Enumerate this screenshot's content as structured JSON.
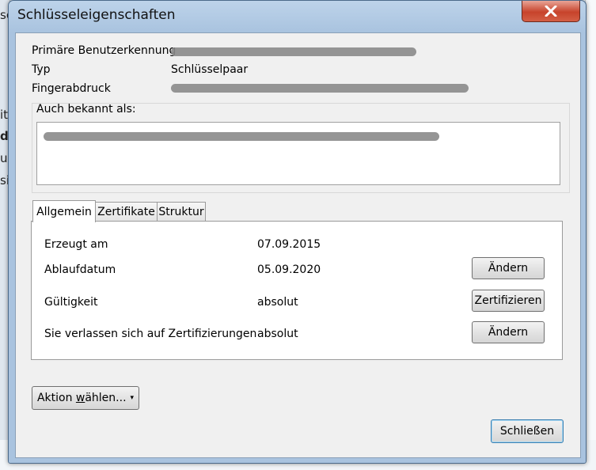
{
  "dialog": {
    "title": "Schlüsseleigenschaften",
    "close_symbol": "✕"
  },
  "properties": {
    "primary_user_id_label": "Primäre Benutzerkennung",
    "type_label": "Typ",
    "type_value": "Schlüsselpaar",
    "fingerprint_label": "Fingerabdruck"
  },
  "also_known_as": {
    "label": "Auch bekannt als:"
  },
  "tabs": [
    {
      "label": "Allgemein",
      "active": true
    },
    {
      "label": "Zertifikate",
      "active": false
    },
    {
      "label": "Struktur",
      "active": false
    }
  ],
  "general": {
    "rows": [
      {
        "label": "Erzeugt am",
        "value": "07.09.2015"
      },
      {
        "label": "Ablaufdatum",
        "value": "05.09.2020",
        "button": "Ändern"
      },
      {
        "label": "Gültigkeit",
        "value": "absolut",
        "button": "Zertifizieren"
      },
      {
        "label": "Sie verlassen sich auf Zertifizierungen",
        "value": "absolut",
        "button": "Ändern"
      }
    ]
  },
  "footer": {
    "action_prefix": "Aktion ",
    "action_underlined": "w",
    "action_suffix": "ählen...",
    "action_arrow": "▾",
    "close_label": "Schließen"
  },
  "background": {
    "fragments": [
      "se",
      "ita",
      "da",
      "up",
      "si"
    ]
  }
}
